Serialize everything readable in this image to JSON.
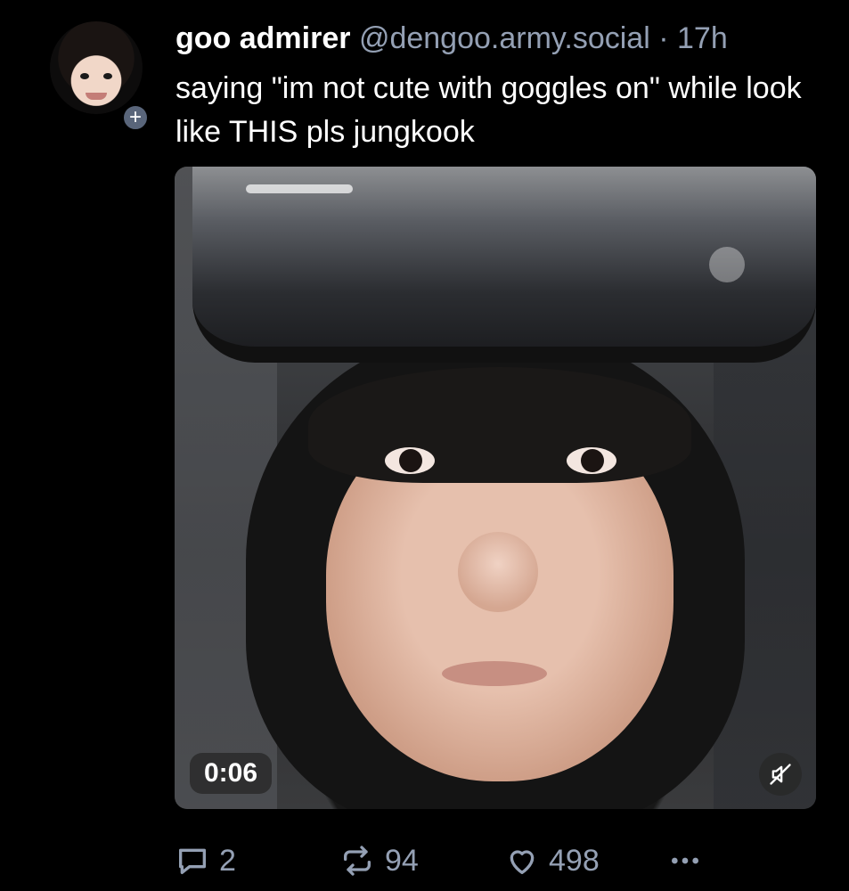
{
  "author": {
    "display_name": "goo admirer",
    "handle": "@dengoo.army.social",
    "separator": "·",
    "time": "17h",
    "follow_badge": "+"
  },
  "post": {
    "text": "saying \"im not cute with goggles on\" while look like THIS pls jungkook"
  },
  "video": {
    "duration": "0:06",
    "muted": true,
    "mute_icon": "speaker-muted-icon"
  },
  "actions": {
    "replies": "2",
    "reposts": "94",
    "likes": "498"
  },
  "colors": {
    "background": "#000000",
    "secondary_text": "#94a0b4",
    "badge": "#59657a"
  }
}
